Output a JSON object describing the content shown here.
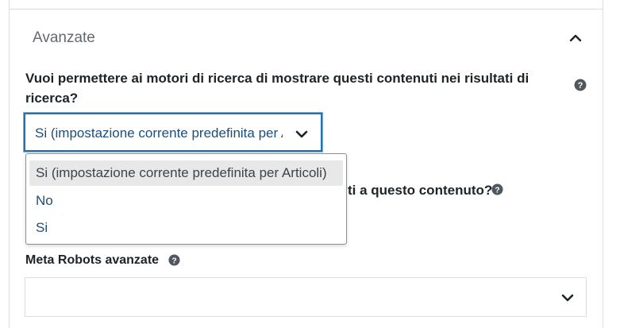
{
  "section": {
    "title": "Avanzate"
  },
  "search_visibility": {
    "question": "Vuoi permettere ai motori di ricerca di mostrare questi contenuti nei risultati di ricerca?",
    "selected_value": "Si (impostazione corrente predefinita per Articoli)",
    "options": [
      {
        "label": "Si (impostazione corrente predefinita per Articoli)",
        "selected": true
      },
      {
        "label": "No",
        "selected": false
      },
      {
        "label": "Si",
        "selected": false
      }
    ]
  },
  "follow_links": {
    "question_visible_tail": "ti a questo contenuto?"
  },
  "meta_robots": {
    "label": "Meta Robots avanzate",
    "value": ""
  },
  "colors": {
    "accent": "#2271b1",
    "text": "#1d2327",
    "option_text": "#1d4e79",
    "selected_bg": "#e8e8e8",
    "border": "#dcdcde"
  },
  "icons": [
    "chevron-up-icon",
    "help-icon",
    "chevron-down-icon"
  ]
}
